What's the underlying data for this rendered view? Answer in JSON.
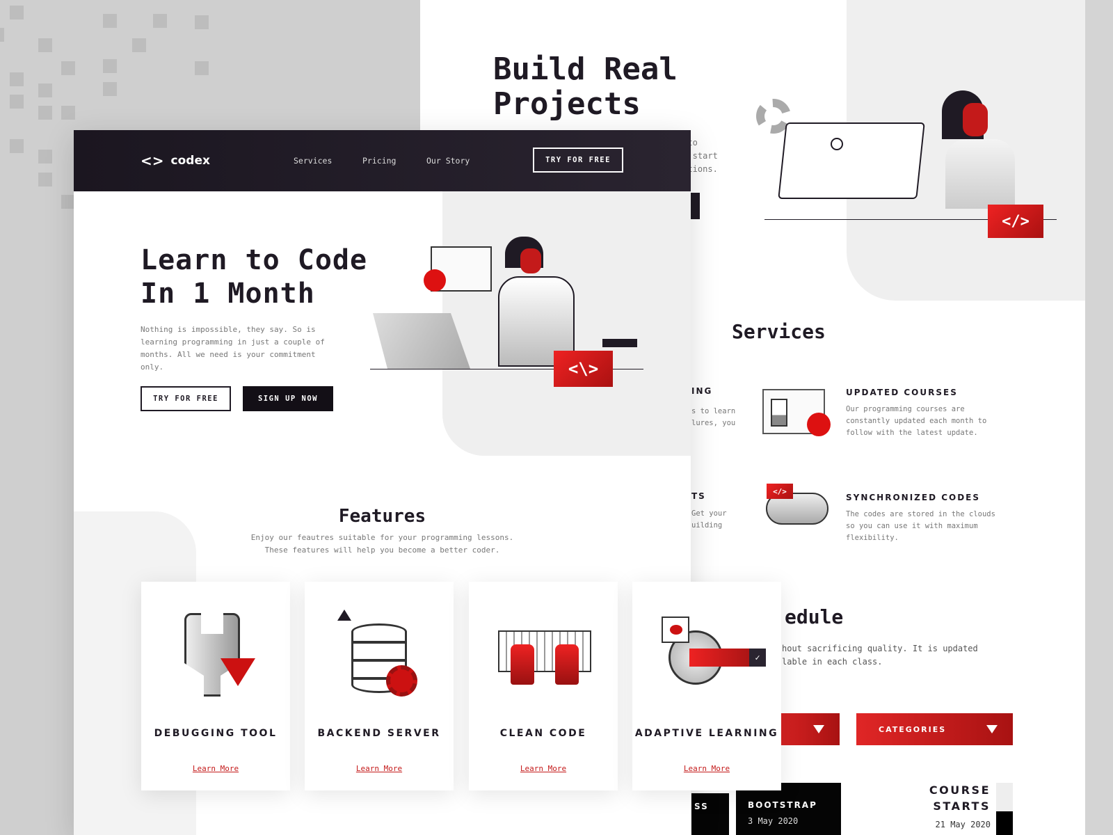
{
  "back_page": {
    "hero_title": "Build Real Projects",
    "hero_text_fragments": [
      "d to",
      "om start",
      "cations."
    ],
    "code_badge": "</>",
    "services": {
      "title": "Services",
      "left_fragments": [
        {
          "title": "ING",
          "text": [
            "s to learn",
            "lures, you"
          ]
        },
        {
          "title": "TS",
          "text": [
            "Get your",
            "uilding"
          ]
        }
      ],
      "items": [
        {
          "title": "UPDATED COURSES",
          "text": "Our programming courses are constantly updated each month to follow with the latest update."
        },
        {
          "title": "SYNCHRONIZED CODES",
          "text": "The codes are stored in the clouds so you can use it with maximum flexibility."
        }
      ]
    },
    "schedule": {
      "title_fragment": "edule",
      "text_fragments": [
        "hout sacrificing quality. It is updated",
        "lable in each class."
      ],
      "dropdowns": [
        {
          "label": ""
        },
        {
          "label": "CATEGORIES"
        }
      ],
      "cards": [
        {
          "title": "SS",
          "date": ""
        },
        {
          "title": "BOOTSTRAP",
          "date": "3 May 2020"
        }
      ],
      "course_starts": {
        "title": "COURSE STARTS",
        "date": "21 May 2020"
      }
    }
  },
  "front_page": {
    "nav": {
      "logo": "codex",
      "links": [
        "Services",
        "Pricing",
        "Our Story"
      ],
      "cta": "TRY FOR FREE"
    },
    "hero": {
      "title_line1": "Learn to Code",
      "title_line2": "In 1 Month",
      "text": "Nothing is impossible, they say. So is learning programming in just a couple of months. All we need is your commitment only.",
      "primary_button": "TRY FOR FREE",
      "secondary_button": "SIGN UP NOW",
      "code_badge": "<\\>"
    },
    "features": {
      "title": "Features",
      "text_line1": "Enjoy our feautres suitable for your programming lessons.",
      "text_line2": "These features will help you become a better coder.",
      "cards": [
        {
          "title": "DEBUGGING TOOL",
          "link": "Learn More",
          "icon": "wrench-bug-icon"
        },
        {
          "title": "BACKEND SERVER",
          "link": "Learn More",
          "icon": "server-icon"
        },
        {
          "title": "CLEAN CODE",
          "link": "Learn More",
          "icon": "keyboard-icon"
        },
        {
          "title": "ADAPTIVE LEARNING",
          "link": "Learn More",
          "icon": "magnifier-icon"
        }
      ]
    }
  },
  "colors": {
    "accent": "#e02626",
    "dark": "#1f1a24",
    "background": "#cfcfcf"
  }
}
